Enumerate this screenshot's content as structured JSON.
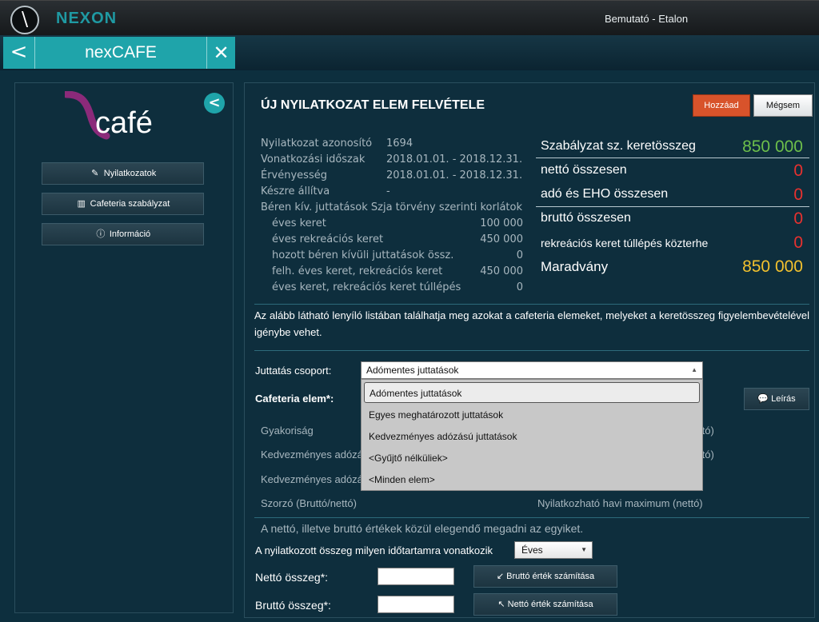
{
  "topbar": {
    "logo_glyph": "\\",
    "brand": "NEXON",
    "user": "Bemutató - Etalon"
  },
  "tab": {
    "back": "<",
    "title": "nexCAFE",
    "close": "✕"
  },
  "sidebar": {
    "logo_text": "café",
    "collapse": "<",
    "items": [
      {
        "label": "Nyilatkozatok",
        "icon": "document-edit-icon"
      },
      {
        "label": "Cafeteria szabályzat",
        "icon": "book-icon"
      },
      {
        "label": "Információ",
        "icon": "info-icon"
      }
    ]
  },
  "main": {
    "title": "ÚJ NYILATKOZAT ELEM FELVÉTELE",
    "add_button": "Hozzáad",
    "cancel_button": "Mégsem",
    "info": [
      {
        "label": "Nyilatkozat azonosító",
        "value": "1694"
      },
      {
        "label": "Vonatkozási időszak",
        "value": "2018.01.01. - 2018.12.31."
      },
      {
        "label": "Érvényesség",
        "value": "2018.01.01. - 2018.12.31."
      },
      {
        "label": "Készre állítva",
        "value": "-"
      }
    ],
    "limits_title": "Béren kív. juttatások Szja törvény szerinti korlátok",
    "limits": [
      {
        "label": "éves keret",
        "value": "100 000"
      },
      {
        "label": "éves rekreációs keret",
        "value": "450 000"
      },
      {
        "label": "hozott béren kívüli juttatások össz.",
        "value": "0"
      },
      {
        "label": "felh. éves keret, rekreációs keret",
        "value": "450 000"
      },
      {
        "label": "éves keret, rekreációs keret túllépés",
        "value": "0"
      }
    ],
    "summary": [
      {
        "label": "Szabályzat sz. keretösszeg",
        "value": "850 000",
        "color": "#6dbf4b"
      },
      {
        "label": "nettó összesen",
        "value": "0",
        "color": "#e8312f"
      },
      {
        "label": "adó és EHO összesen",
        "value": "0",
        "color": "#e8312f"
      },
      {
        "label": "bruttó összesen",
        "value": "0",
        "color": "#e8312f"
      },
      {
        "label": "rekreációs keret túllépés közterhe",
        "value": "0",
        "color": "#e8312f"
      },
      {
        "label": "Maradvány",
        "value": "850 000",
        "color": "#f2c12e"
      }
    ],
    "paragraph": "Az alább látható lenyíló listában találhatja meg azokat a cafeteria elemeket, melyeket a keretösszeg figyelembevételével igénybe vehet.",
    "group_label": "Juttatás csoport:",
    "group_selected": "Adómentes juttatások",
    "group_options": [
      "Adómentes juttatások",
      "Egyes meghatározott juttatások",
      "Kedvezményes adózású juttatások",
      "<Gyűjtő nélküliek>",
      "<Minden elem>"
    ],
    "element_label": "Cafeteria elem*:",
    "leiras_button": "Leírás",
    "hidden_rows": [
      {
        "left": "Gyakoriság",
        "right": "ttó)"
      },
      {
        "left": "Kedvezményes adózá",
        "right": "ttó)"
      },
      {
        "left": "Kedvezményes adózá",
        "right": ""
      }
    ],
    "szorzo_label": "Szorzó (Bruttó/nettó)",
    "max_label": "Nyilatkozható havi maximum (nettó)",
    "hint": "A nettó, illetve bruttó értékek közül elegendő megadni az egyiket.",
    "period_label": "A nyilatkozott összeg milyen időtartamra vonatkozik",
    "period_value": "Éves",
    "net_label": "Nettó összeg*:",
    "gross_label": "Bruttó összeg*:",
    "calc_gross_button": "Bruttó érték számítása",
    "calc_net_button": "Nettó érték számítása"
  }
}
